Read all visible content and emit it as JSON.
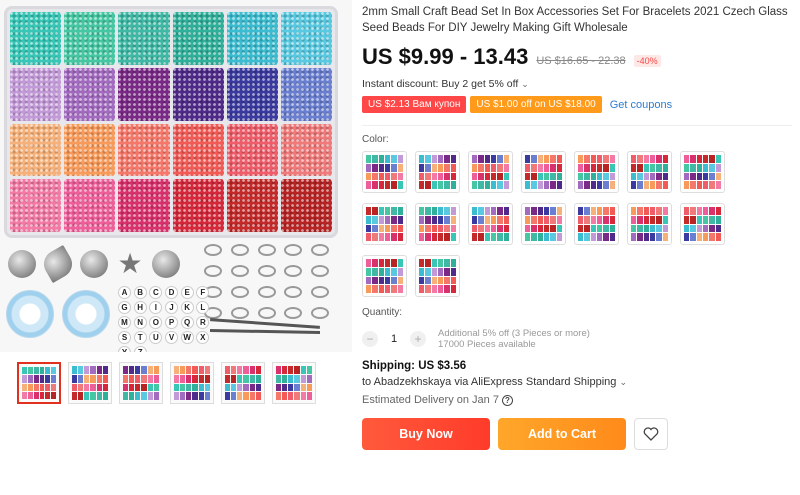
{
  "product": {
    "title": "2mm Small Craft Bead Set In Box Accessories Set For Bracelets 2021 Czech Glass Seed Beads For DIY Jewelry Making Gift Wholesale",
    "price": "US $9.99 - 13.43",
    "old_price": "US $16.65 - 22.38",
    "discount": "-40%",
    "instant_discount": "Instant discount: Buy 2 get 5% off",
    "coupon_1": "US $2.13 Вам купон",
    "coupon_2": "US $1.00 off on US $18.00",
    "get_coupons": "Get coupons"
  },
  "color": {
    "label": "Color:"
  },
  "quantity": {
    "label": "Quantity:",
    "value": "1",
    "minus": "−",
    "plus": "+",
    "note_1": "Additional 5% off (3 Pieces or more)",
    "note_2": "17000 Pieces available"
  },
  "shipping": {
    "label": "Shipping:",
    "cost": "US $3.56",
    "to": "to Abadzekhskaya via AliExpress Standard Shipping",
    "delivery": "Estimated Delivery on Jan 7"
  },
  "actions": {
    "buy_now": "Buy Now",
    "add_to_cart": "Add to Cart"
  },
  "gallery": {
    "letters": [
      "A",
      "B",
      "C",
      "D",
      "E",
      "F",
      "G",
      "H",
      "I",
      "J",
      "K",
      "L",
      "M",
      "N",
      "O",
      "P",
      "Q",
      "R",
      "S",
      "T",
      "U",
      "V",
      "W",
      "X",
      "Y",
      "Z"
    ]
  },
  "colors": {
    "tray": [
      "#38c6b6",
      "#46c7a3",
      "#3fb8a5",
      "#2fb09a",
      "#3cbcd0",
      "#58c9e0",
      "#c39ad8",
      "#a36bc0",
      "#7a2a86",
      "#4f2a8a",
      "#3a3aa0",
      "#6a7fd0",
      "#f6b17a",
      "#f79a5a",
      "#f5776a",
      "#f25a55",
      "#ef5d6a",
      "#f07a7a",
      "#f27aa4",
      "#ee5f9a",
      "#d8316c",
      "#d6283a",
      "#c52a2a",
      "#b82424"
    ],
    "accent": "#ff4747"
  }
}
